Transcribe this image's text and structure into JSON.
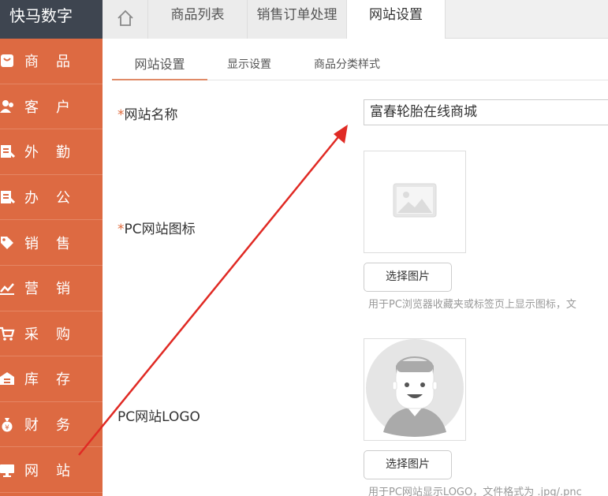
{
  "app": {
    "brand": "快马数字"
  },
  "sidebar": {
    "items": [
      {
        "label": "商品",
        "icon": "bag-icon"
      },
      {
        "label": "客户",
        "icon": "users-icon"
      },
      {
        "label": "外勤",
        "icon": "clipboard-icon"
      },
      {
        "label": "办公",
        "icon": "clipboard-icon"
      },
      {
        "label": "销售",
        "icon": "tag-icon"
      },
      {
        "label": "营销",
        "icon": "trend-icon"
      },
      {
        "label": "采购",
        "icon": "cart-icon"
      },
      {
        "label": "库存",
        "icon": "warehouse-icon"
      },
      {
        "label": "财务",
        "icon": "money-bag-icon"
      },
      {
        "label": "网站",
        "icon": "monitor-icon"
      }
    ]
  },
  "top_tabs": [
    "商品列表",
    "销售订单处理",
    "网站设置"
  ],
  "sub_tabs": [
    "网站设置",
    "显示设置",
    "商品分类样式"
  ],
  "form": {
    "site_name": {
      "required_mark": "*",
      "label": "网站名称",
      "value": "富春轮胎在线商城"
    },
    "pc_icon": {
      "required_mark": "*",
      "label": "PC网站图标",
      "button": "选择图片",
      "help": "用于PC浏览器收藏夹或标签页上显示图标，文"
    },
    "pc_logo": {
      "label": "PC网站LOGO",
      "button": "选择图片",
      "help": "用于PC网站显示LOGO，文件格式为 .jpg/.pnc"
    }
  },
  "colors": {
    "sidebar": "#dd6a42",
    "brand_bg": "#3e4550",
    "accent": "#e08a67",
    "annotation": "#e02a24"
  }
}
